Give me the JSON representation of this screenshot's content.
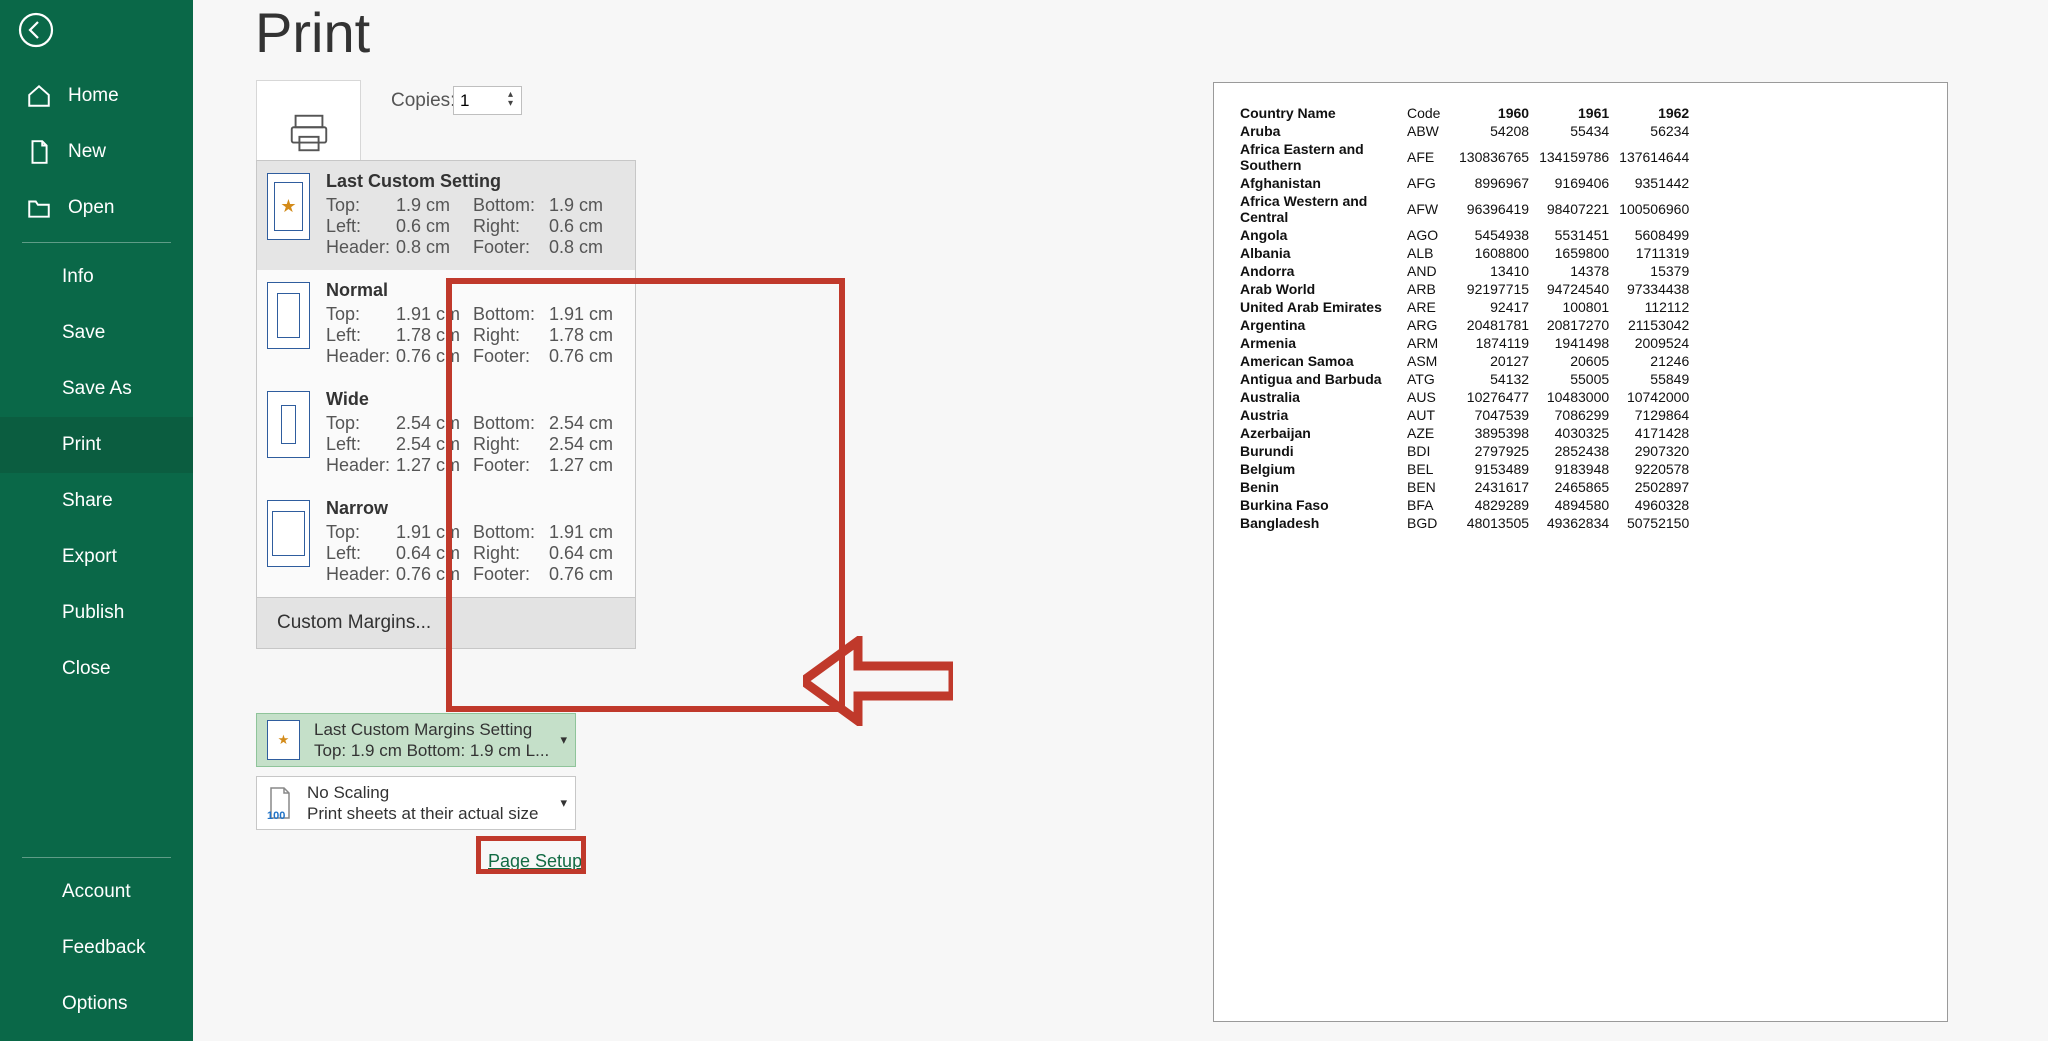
{
  "backstage": {
    "items": [
      {
        "label": "Home"
      },
      {
        "label": "New"
      },
      {
        "label": "Open"
      },
      {
        "label": "Info"
      },
      {
        "label": "Save"
      },
      {
        "label": "Save As"
      },
      {
        "label": "Print"
      },
      {
        "label": "Share"
      },
      {
        "label": "Export"
      },
      {
        "label": "Publish"
      },
      {
        "label": "Close"
      },
      {
        "label": "Account"
      },
      {
        "label": "Feedback"
      },
      {
        "label": "Options"
      }
    ]
  },
  "title": "Print",
  "copies_label": "Copies:",
  "copies_value": "1",
  "margins": {
    "items": [
      {
        "name": "Last Custom Setting",
        "top": "1.9 cm",
        "bottom": "1.9 cm",
        "left": "0.6 cm",
        "right": "0.6 cm",
        "header": "0.8 cm",
        "footer": "0.8 cm"
      },
      {
        "name": "Normal",
        "top": "1.91 cm",
        "bottom": "1.91 cm",
        "left": "1.78 cm",
        "right": "1.78 cm",
        "header": "0.76 cm",
        "footer": "0.76 cm"
      },
      {
        "name": "Wide",
        "top": "2.54 cm",
        "bottom": "2.54 cm",
        "left": "2.54 cm",
        "right": "2.54 cm",
        "header": "1.27 cm",
        "footer": "1.27 cm"
      },
      {
        "name": "Narrow",
        "top": "1.91 cm",
        "bottom": "1.91 cm",
        "left": "0.64 cm",
        "right": "0.64 cm",
        "header": "0.76 cm",
        "footer": "0.76 cm"
      }
    ],
    "labels": {
      "top": "Top:",
      "bottom": "Bottom:",
      "left": "Left:",
      "right": "Right:",
      "header": "Header:",
      "footer": "Footer:"
    },
    "custom": "Custom Margins..."
  },
  "margins_current": {
    "title": "Last Custom Margins Setting",
    "sub": "Top: 1.9 cm Bottom: 1.9 cm L..."
  },
  "no_scaling": {
    "title": "No Scaling",
    "sub": "Print sheets at their actual size",
    "badge": "100"
  },
  "page_setup": "Page Setup",
  "preview": {
    "headers": [
      "Country Name",
      "Code",
      "1960",
      "1961",
      "1962"
    ],
    "rows": [
      [
        "Aruba",
        "ABW",
        "54208",
        "55434",
        "56234"
      ],
      [
        "Africa Eastern and Southern",
        "AFE",
        "130836765",
        "134159786",
        "137614644"
      ],
      [
        "Afghanistan",
        "AFG",
        "8996967",
        "9169406",
        "9351442"
      ],
      [
        "Africa Western and Central",
        "AFW",
        "96396419",
        "98407221",
        "100506960"
      ],
      [
        "Angola",
        "AGO",
        "5454938",
        "5531451",
        "5608499"
      ],
      [
        "Albania",
        "ALB",
        "1608800",
        "1659800",
        "1711319"
      ],
      [
        "Andorra",
        "AND",
        "13410",
        "14378",
        "15379"
      ],
      [
        "Arab World",
        "ARB",
        "92197715",
        "94724540",
        "97334438"
      ],
      [
        "United Arab Emirates",
        "ARE",
        "92417",
        "100801",
        "112112"
      ],
      [
        "Argentina",
        "ARG",
        "20481781",
        "20817270",
        "21153042"
      ],
      [
        "Armenia",
        "ARM",
        "1874119",
        "1941498",
        "2009524"
      ],
      [
        "American Samoa",
        "ASM",
        "20127",
        "20605",
        "21246"
      ],
      [
        "Antigua and Barbuda",
        "ATG",
        "54132",
        "55005",
        "55849"
      ],
      [
        "Australia",
        "AUS",
        "10276477",
        "10483000",
        "10742000"
      ],
      [
        "Austria",
        "AUT",
        "7047539",
        "7086299",
        "7129864"
      ],
      [
        "Azerbaijan",
        "AZE",
        "3895398",
        "4030325",
        "4171428"
      ],
      [
        "Burundi",
        "BDI",
        "2797925",
        "2852438",
        "2907320"
      ],
      [
        "Belgium",
        "BEL",
        "9153489",
        "9183948",
        "9220578"
      ],
      [
        "Benin",
        "BEN",
        "2431617",
        "2465865",
        "2502897"
      ],
      [
        "Burkina Faso",
        "BFA",
        "4829289",
        "4894580",
        "4960328"
      ],
      [
        "Bangladesh",
        "BGD",
        "48013505",
        "49362834",
        "50752150"
      ]
    ]
  }
}
